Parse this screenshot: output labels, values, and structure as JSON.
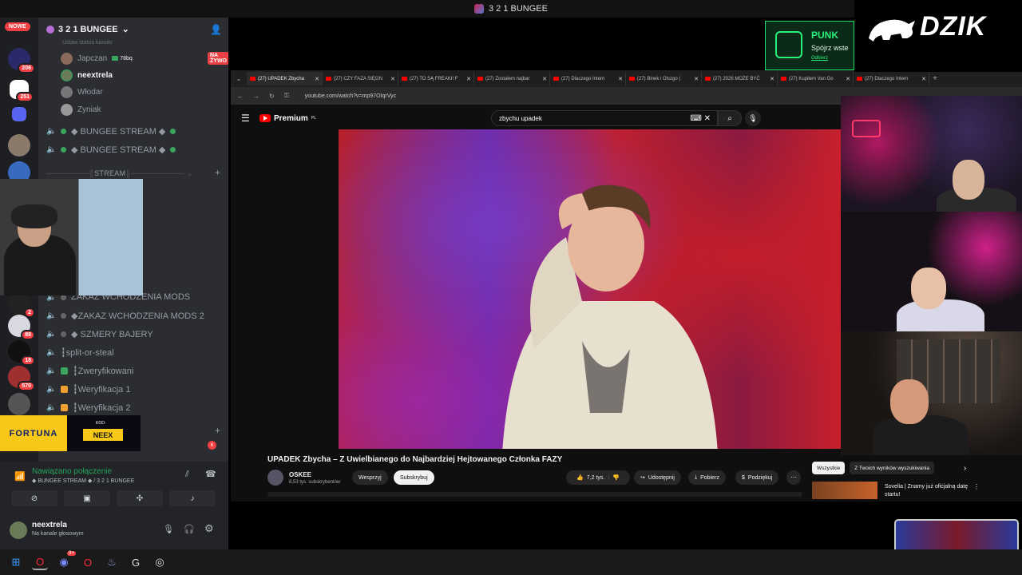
{
  "window_title": "3 2 1 BUNGEE",
  "rail": {
    "new_badge": "NOWE",
    "badges": [
      "206",
      "251",
      "2",
      "88",
      "18",
      "570",
      "6"
    ]
  },
  "server": {
    "name": "3 2 1 BUNGEE",
    "status_hint": "Ustaw status kanału",
    "voice_users": [
      {
        "name": "Japczan",
        "activity": "78bq",
        "live": "NA ŻYWO"
      },
      {
        "name": "neextrela"
      },
      {
        "name": "Włodar"
      },
      {
        "name": "Zyniak"
      }
    ],
    "channels_top": [
      "◆ BUNGEE STREAM ◆",
      "◆ BUNGEE STREAM ◆"
    ],
    "category_stream": "STREAM",
    "channels_bottom": [
      {
        "name": "ZAKAZ WCHODZENIA MODS",
        "icon": "speaker-icon"
      },
      {
        "name": "◆ZAKAZ WCHODZENIA MODS 2",
        "icon": "speaker-icon"
      },
      {
        "name": "◆ SZMERY BAJERY",
        "icon": "speaker-icon"
      },
      {
        "name": "┇split-or-steal",
        "icon": "speaker-icon"
      },
      {
        "name": "┇Zweryfikowani",
        "icon": "speaker-icon",
        "color": "#3ba55d"
      },
      {
        "name": "┇Weryfikacja 1",
        "icon": "speaker-icon",
        "color": "#f0a030"
      },
      {
        "name": "┇Weryfikacja 2",
        "icon": "speaker-icon",
        "color": "#f0a030"
      }
    ]
  },
  "voice": {
    "status": "Nawiązano połączenie",
    "channel": "◆ BUNGEE STREAM ◆ / 3 2 1 BUNGEE"
  },
  "user": {
    "name": "neextrela",
    "status": "Na kanale głosowym"
  },
  "browser": {
    "tabs": [
      "(27) UPADEK Zbycha",
      "(27) CZY FAZA SIĘGN",
      "(27) TO SĄ FREAKI! F",
      "(27) Zostałem najbar",
      "(27) Dlaczego Intern",
      "(27) Binek i Olszgo |",
      "(27) 2026 MOŻE BYĆ",
      "(27) Kupiłem Van Go",
      "(27) Dlaczego Intern"
    ],
    "url": "youtube.com/watch?v=mp97OIqrVyc"
  },
  "youtube": {
    "logo": "Premium",
    "logo_sup": "PL",
    "search_query": "zbychu upadek",
    "video_title": "UPADEK Zbycha – Z Uwielbianego do Najbardziej Hejtowanego Członka FAZY",
    "channel": "OSKEE",
    "subscribers": "8,53 tys. subskrybentów",
    "support_label": "Wesprzyj",
    "subscribe_label": "Subskrybuj",
    "likes": "7,2 tys.",
    "share_label": "Udostępnij",
    "download_label": "Pobierz",
    "thanks_label": "Podziękuj",
    "chips": [
      "Wszystkie",
      "Z Twoich wyników wyszukiwania"
    ],
    "rec_title": "Sovelia | Znamy już oficjalną datę startu!"
  },
  "sponsors": {
    "punk_name": "PUNK",
    "punk_sub": "Spójrz wste",
    "punk_link": "Odbierz",
    "dzik": "DZIK",
    "fortuna": "FORTUNA",
    "fortuna_kod_label": "KOD:",
    "fortuna_kod": "NEEX"
  },
  "colors": {
    "discord_bg": "#2b2d31",
    "live_red": "#ed4245",
    "connected_green": "#23a55a",
    "punk_green": "#29f07a",
    "fortuna_yellow": "#f7c818"
  }
}
